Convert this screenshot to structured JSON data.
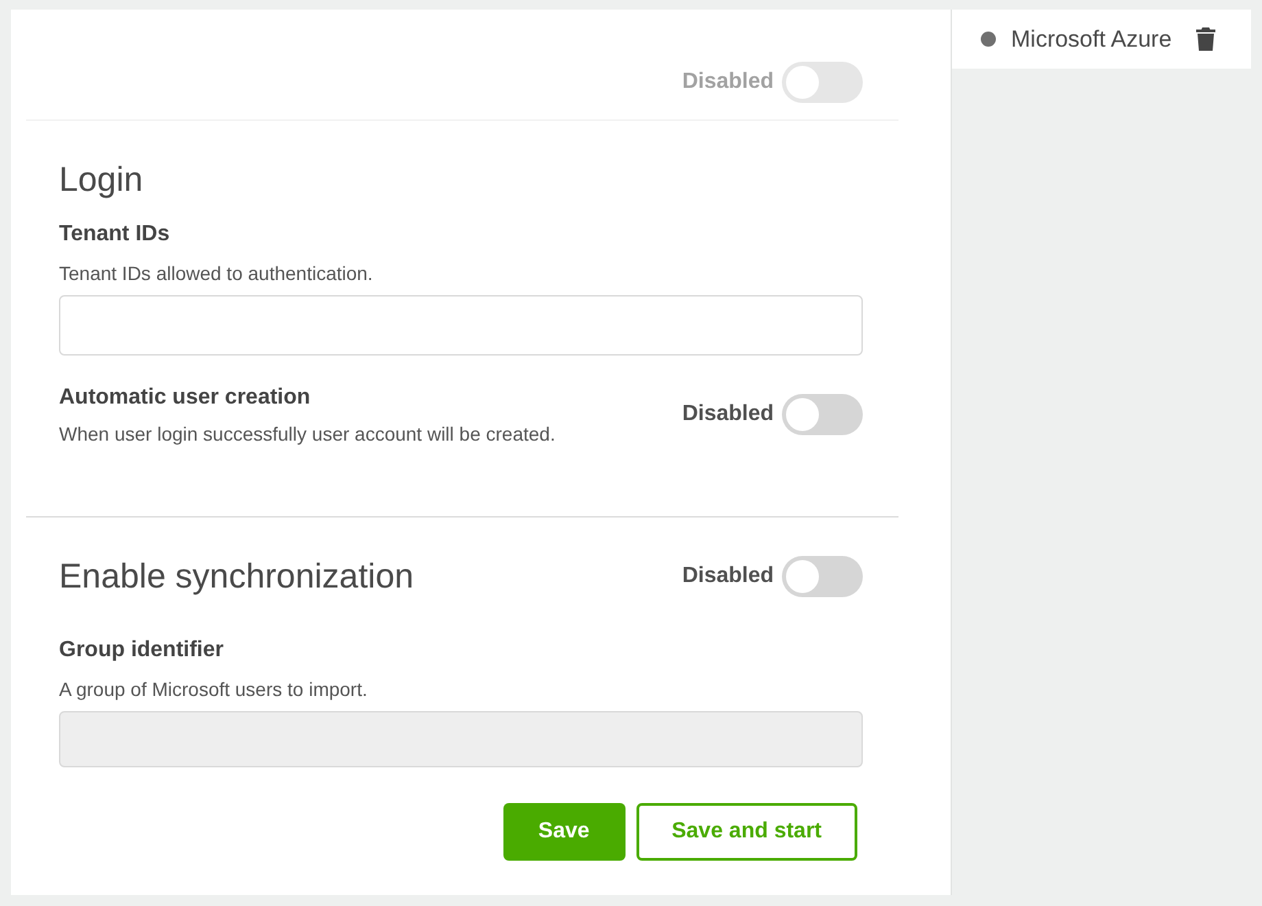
{
  "top": {
    "toggle": {
      "label": "Disabled",
      "on": false,
      "faded": true
    }
  },
  "sections": [
    {
      "title": "Login",
      "fields": [
        {
          "kind": "input",
          "label": "Tenant IDs",
          "description": "Tenant IDs allowed to authentication.",
          "disabled": false
        },
        {
          "kind": "switch",
          "label": "Automatic user creation",
          "description": "When user login successfully user account will be created.",
          "toggle": {
            "label": "Disabled",
            "on": false,
            "faded": false
          }
        }
      ]
    },
    {
      "title": "Enable synchronization",
      "toggle": {
        "label": "Disabled",
        "on": false,
        "faded": false
      },
      "fields": [
        {
          "kind": "input",
          "label": "Group identifier",
          "description": "A group of Microsoft users to import.",
          "disabled": true
        }
      ]
    }
  ],
  "buttons": [
    {
      "kind": "primary",
      "label": "Save"
    },
    {
      "kind": "outline",
      "label": "Save and start"
    }
  ],
  "connections": [
    {
      "name": "Microsoft Azure",
      "color": "#707070"
    }
  ]
}
